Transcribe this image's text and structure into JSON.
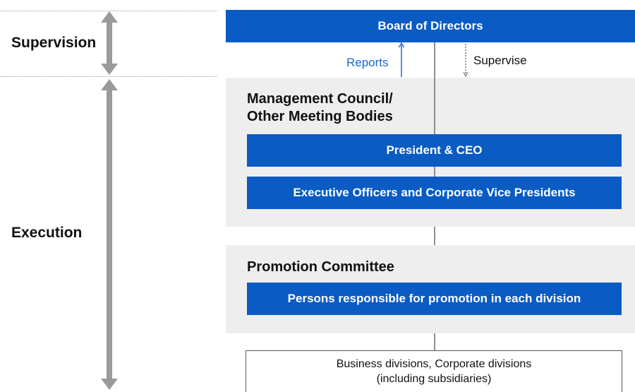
{
  "sides": {
    "supervision": "Supervision",
    "execution": "Execution"
  },
  "board": "Board of Directors",
  "links": {
    "reports": "Reports",
    "supervise": "Supervise"
  },
  "management": {
    "title_line1": "Management Council/",
    "title_line2": "Other Meeting Bodies",
    "president": "President & CEO",
    "officers": "Executive Officers and Corporate Vice Presidents"
  },
  "promotion": {
    "title": "Promotion Committee",
    "persons": "Persons responsible for promotion in each division"
  },
  "business": {
    "line1": "Business divisions, Corporate divisions",
    "line2": "(including subsidiaries)"
  },
  "colors": {
    "primary_blue": "#0a5bc4",
    "report_blue": "#1a66d0",
    "panel_gray": "#eeeeee",
    "arrow_gray": "#9a9a9a"
  }
}
